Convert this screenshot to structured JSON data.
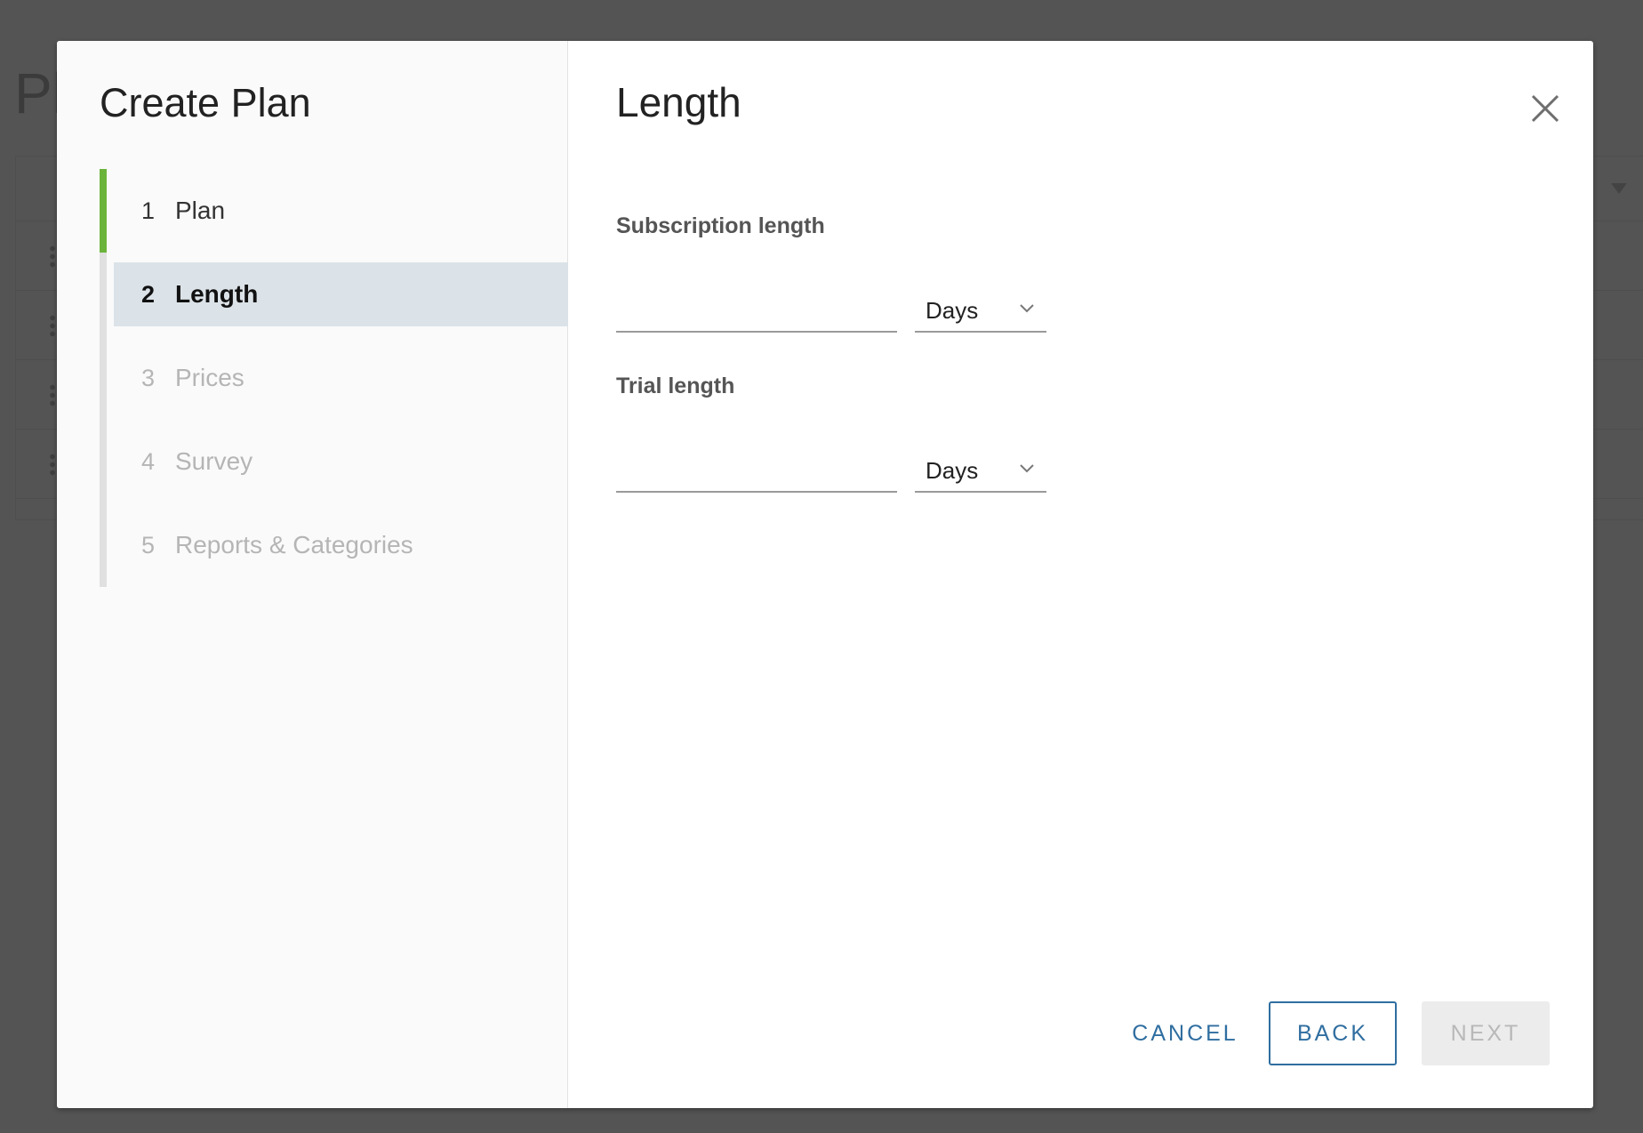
{
  "background": {
    "page_title_fragment": "Pl"
  },
  "wizard": {
    "title": "Create Plan",
    "steps": [
      {
        "number": "1",
        "label": "Plan",
        "state": "done"
      },
      {
        "number": "2",
        "label": "Length",
        "state": "current"
      },
      {
        "number": "3",
        "label": "Prices",
        "state": "pending"
      },
      {
        "number": "4",
        "label": "Survey",
        "state": "pending"
      },
      {
        "number": "5",
        "label": "Reports & Categories",
        "state": "pending"
      }
    ]
  },
  "content": {
    "title": "Length",
    "subscription": {
      "label": "Subscription length",
      "value": "",
      "unit": "Days"
    },
    "trial": {
      "label": "Trial length",
      "value": "",
      "unit": "Days"
    }
  },
  "footer": {
    "cancel_label": "CANCEL",
    "back_label": "BACK",
    "next_label": "NEXT"
  },
  "colors": {
    "done_step_accent": "#6bb43b",
    "current_step_highlight": "#dce3e8",
    "action_blue": "#2f6ea0",
    "disabled_gray": "#b8b8b8"
  },
  "icons": {
    "close": "close-icon",
    "dropdown": "chevron-down-icon",
    "filter": "filter-icon",
    "row_handle": "drag-handle-icon"
  }
}
